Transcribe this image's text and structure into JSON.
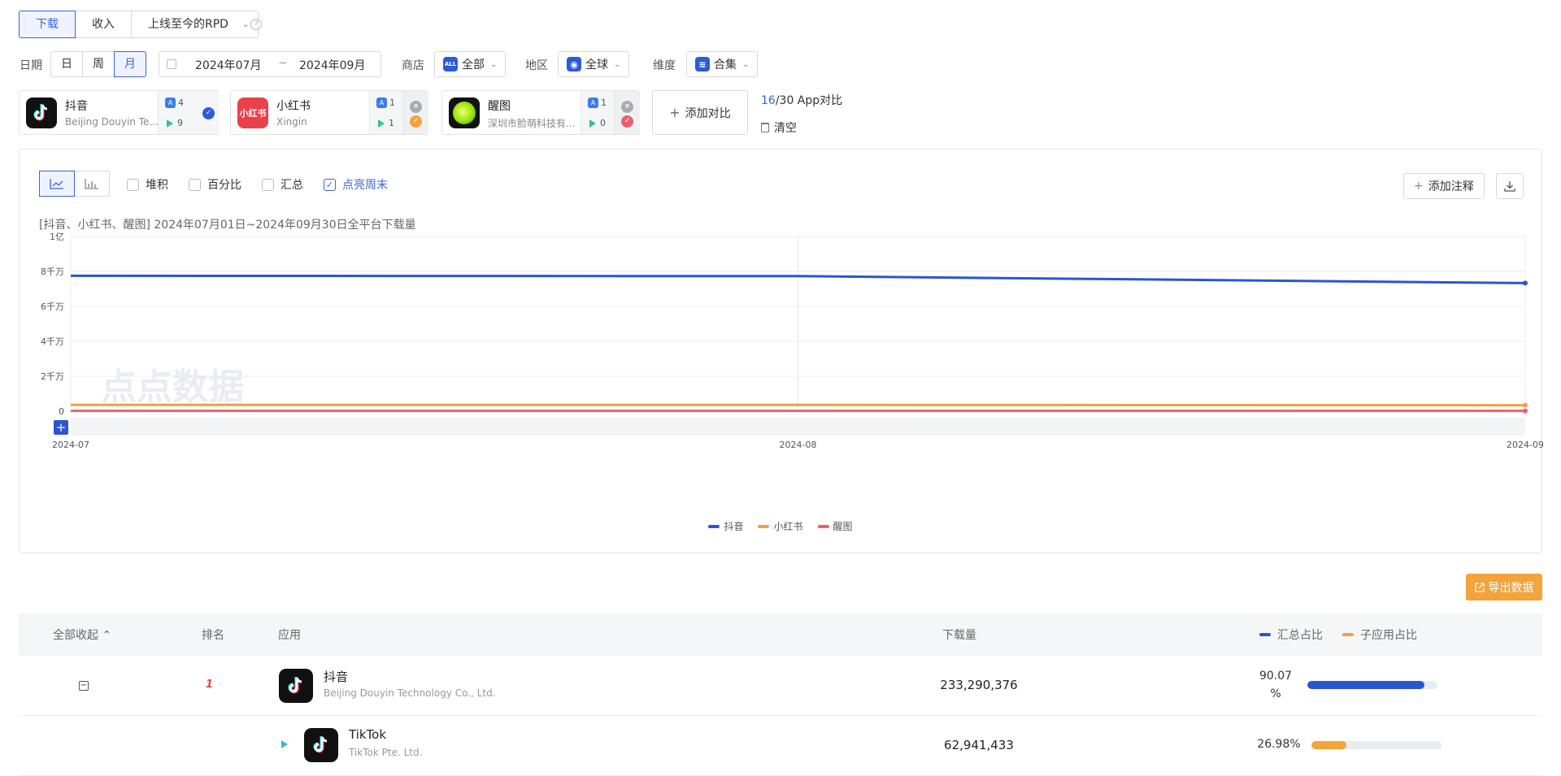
{
  "metric_tabs": [
    "下载",
    "收入",
    "上线至今的RPD"
  ],
  "filters": {
    "date_label": "日期",
    "granularity": [
      "日",
      "周",
      "月"
    ],
    "date_start": "2024年07月",
    "date_sep": "~",
    "date_end": "2024年09月",
    "store_label": "商店",
    "store_value": "全部",
    "store_icon_text": "ALL",
    "region_label": "地区",
    "region_value": "全球",
    "dimension_label": "维度",
    "dimension_value": "合集"
  },
  "apps": [
    {
      "name": "抖音",
      "developer": "Beijing Douyin Te...",
      "ios_count": "4",
      "android_count": "9",
      "color": "#2c5bd9"
    },
    {
      "name": "小红书",
      "developer": "Xingin",
      "ios_count": "1",
      "android_count": "1",
      "color": "#f2a33a",
      "logo_text": "小红书"
    },
    {
      "name": "醒图",
      "developer": "深圳市脸萌科技有...",
      "ios_count": "1",
      "android_count": "0",
      "color": "#e9606d"
    }
  ],
  "add_compare": "添加对比",
  "compare_count": {
    "current": "16",
    "rest": "/30 App对比"
  },
  "clear_label": "清空",
  "chart_controls": {
    "options": [
      "堆积",
      "百分比",
      "汇总",
      "点亮周末"
    ],
    "annotate": "添加注释"
  },
  "chart_subtitle": "[抖音、小红书、醒图] 2024年07月01日~2024年09月30日全平台下载量",
  "chart_data": {
    "type": "line",
    "x": [
      "2024-07",
      "2024-08",
      "2024-09"
    ],
    "y_ticks": [
      "0",
      "2千万",
      "4千万",
      "6千万",
      "8千万",
      "1亿"
    ],
    "ylim": [
      0,
      100000000
    ],
    "series": [
      {
        "name": "抖音",
        "color": "#2c55d4",
        "values": [
          77500000,
          77300000,
          73300000
        ]
      },
      {
        "name": "小红书",
        "color": "#f0a040",
        "values": [
          3600000,
          3600000,
          3400000
        ]
      },
      {
        "name": "醒图",
        "color": "#e9606d",
        "values": [
          200000,
          200000,
          200000
        ]
      }
    ],
    "watermark": "点点数据",
    "legend_position": "bottom"
  },
  "export_label": "导出数据",
  "table": {
    "headers": {
      "collapse": "全部收起",
      "rank": "排名",
      "app": "应用",
      "downloads": "下载量",
      "total_share": "汇总占比",
      "sub_share": "子应用占比"
    },
    "rows": [
      {
        "name": "抖音",
        "developer": "Beijing Douyin Technology Co., Ltd.",
        "downloads": "233,290,376",
        "pct": "90.07%",
        "pct_a": "90.07",
        "pct_b": "%",
        "share": 0.9007,
        "rank": "1"
      },
      {
        "name": "TikTok",
        "developer": "TikTok Pte. Ltd.",
        "downloads": "62,941,433",
        "pct": "26.98%",
        "share": 0.2698
      }
    ]
  },
  "colors": {
    "accent": "#3a64db",
    "orange": "#f2a33a",
    "pink": "#e9606d"
  }
}
